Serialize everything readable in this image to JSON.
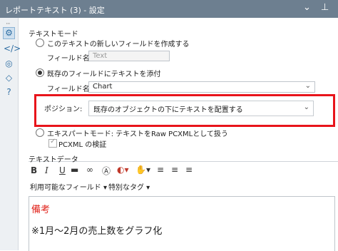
{
  "window": {
    "title": "レポートテキスト (3) - 設定"
  },
  "text_mode": {
    "heading": "テキストモード",
    "option_new": "このテキストの新しいフィールドを作成する",
    "field_name_label": "フィールド名:",
    "field_name_value": "Text",
    "option_existing": "既存のフィールドにテキストを添付",
    "existing_field_label": "フィールド名:",
    "existing_field_value": "Chart",
    "position_label": "ポジション:",
    "position_value": "既存のオブジェクトの下にテキストを配置する",
    "option_expert": "エキスパートモード: テキストをRaw PCXMLとして扱う",
    "pcxml_check_label": "PCXML の検証"
  },
  "text_data": {
    "heading": "テキストデータ",
    "menu_fields": "利用可能なフィールド ▾",
    "menu_special_tags": "特別なタグ ▾",
    "line1": "備考",
    "line2": "※1月～2月の売上数をグラフ化",
    "colors": {
      "line1": "#e0221a",
      "line2": "#222222"
    }
  },
  "colors": {
    "titlebar": "#6d7f90",
    "highlight": "#e8141b",
    "rail_icon": "#2f6ea3"
  }
}
